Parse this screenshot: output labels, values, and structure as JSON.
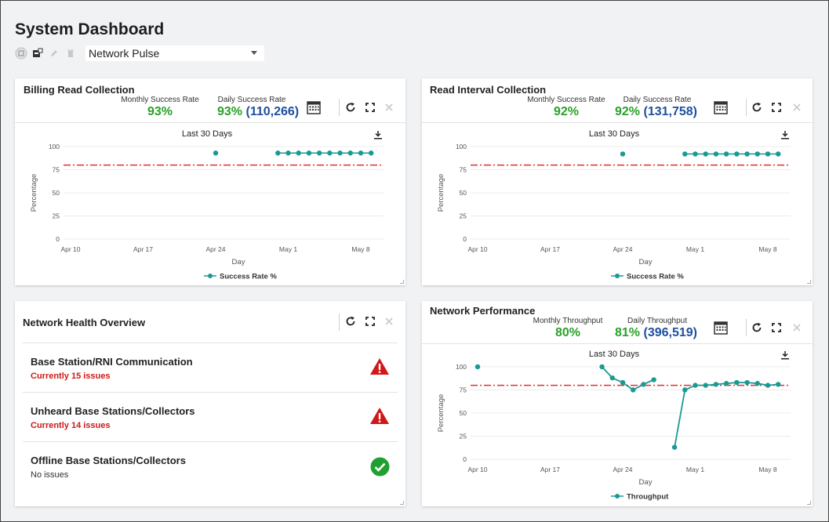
{
  "page": {
    "title": "System Dashboard"
  },
  "toolbar": {
    "selected_view": "Network Pulse"
  },
  "colors": {
    "accent_green": "#2aa02a",
    "accent_blue": "#1f4f9e",
    "teal": "#1a9a94",
    "threshold_red": "#e03030",
    "alert_red": "#d01818"
  },
  "cards": {
    "billing": {
      "title": "Billing Read Collection",
      "monthly_label": "Monthly Success Rate",
      "monthly_value": "93%",
      "daily_label": "Daily Success Rate",
      "daily_pct": "93%",
      "daily_count": "(110,266)",
      "range_label": "Last 30 Days"
    },
    "interval": {
      "title": "Read Interval Collection",
      "monthly_label": "Monthly Success Rate",
      "monthly_value": "92%",
      "daily_label": "Daily Success Rate",
      "daily_pct": "92%",
      "daily_count": "(131,758)",
      "range_label": "Last 30 Days"
    },
    "health": {
      "title": "Network Health Overview",
      "items": [
        {
          "title": "Base Station/RNI Communication",
          "status": "Currently 15 issues",
          "icon": "warning-icon"
        },
        {
          "title": "Unheard Base Stations/Collectors",
          "status": "Currently 14 issues",
          "icon": "warning-icon"
        },
        {
          "title": "Offline Base Stations/Collectors",
          "status": "No issues",
          "icon": "check-circle-icon"
        }
      ]
    },
    "performance": {
      "title": "Network Performance",
      "monthly_label": "Monthly Throughput",
      "monthly_value": "80%",
      "daily_label": "Daily Throughput",
      "daily_pct": "81%",
      "daily_count": "(396,519)",
      "range_label": "Last 30 Days"
    }
  },
  "chart_data": [
    {
      "id": "billing",
      "type": "line",
      "xlabel": "Day",
      "ylabel": "Percentage",
      "x_tick_labels": [
        "Apr 10",
        "Apr 17",
        "Apr 24",
        "May 1",
        "May 8"
      ],
      "x_tick_dates": [
        "2024-04-10",
        "2024-04-17",
        "2024-04-24",
        "2024-05-01",
        "2024-05-08"
      ],
      "y_ticks": [
        0,
        25,
        50,
        75,
        100
      ],
      "ylim": [
        0,
        100
      ],
      "threshold": 80,
      "series": [
        {
          "name": "Success Rate %",
          "color": "#1a9a94",
          "connect": false,
          "points": [
            [
              "2024-04-24",
              93
            ],
            [
              "2024-04-30",
              93
            ],
            [
              "2024-05-01",
              93
            ],
            [
              "2024-05-02",
              93
            ],
            [
              "2024-05-03",
              93
            ],
            [
              "2024-05-04",
              93
            ],
            [
              "2024-05-05",
              93
            ],
            [
              "2024-05-06",
              93
            ],
            [
              "2024-05-07",
              93
            ],
            [
              "2024-05-08",
              93
            ],
            [
              "2024-05-09",
              93
            ]
          ]
        }
      ]
    },
    {
      "id": "interval",
      "type": "line",
      "xlabel": "Day",
      "ylabel": "Percentage",
      "x_tick_labels": [
        "Apr 10",
        "Apr 17",
        "Apr 24",
        "May 1",
        "May 8"
      ],
      "x_tick_dates": [
        "2024-04-10",
        "2024-04-17",
        "2024-04-24",
        "2024-05-01",
        "2024-05-08"
      ],
      "y_ticks": [
        0,
        25,
        50,
        75,
        100
      ],
      "ylim": [
        0,
        100
      ],
      "threshold": 80,
      "series": [
        {
          "name": "Success Rate %",
          "color": "#1a9a94",
          "connect": false,
          "points": [
            [
              "2024-04-24",
              92
            ],
            [
              "2024-04-30",
              92
            ],
            [
              "2024-05-01",
              92
            ],
            [
              "2024-05-02",
              92
            ],
            [
              "2024-05-03",
              92
            ],
            [
              "2024-05-04",
              92
            ],
            [
              "2024-05-05",
              92
            ],
            [
              "2024-05-06",
              92
            ],
            [
              "2024-05-07",
              92
            ],
            [
              "2024-05-08",
              92
            ],
            [
              "2024-05-09",
              92
            ]
          ]
        }
      ]
    },
    {
      "id": "performance",
      "type": "line",
      "xlabel": "Day",
      "ylabel": "Percentage",
      "x_tick_labels": [
        "Apr 10",
        "Apr 17",
        "Apr 24",
        "May 1",
        "May 8"
      ],
      "x_tick_dates": [
        "2024-04-10",
        "2024-04-17",
        "2024-04-24",
        "2024-05-01",
        "2024-05-08"
      ],
      "y_ticks": [
        0,
        25,
        50,
        75,
        100
      ],
      "ylim": [
        0,
        100
      ],
      "threshold": 80,
      "series": [
        {
          "name": "Throughput",
          "color": "#1a9a94",
          "connect": true,
          "segments": [
            [
              [
                "2024-04-10",
                100
              ]
            ],
            [
              [
                "2024-04-22",
                100
              ],
              [
                "2024-04-23",
                88
              ],
              [
                "2024-04-24",
                83
              ],
              [
                "2024-04-25",
                75
              ],
              [
                "2024-04-26",
                81
              ],
              [
                "2024-04-27",
                86
              ]
            ],
            [
              [
                "2024-04-29",
                13
              ],
              [
                "2024-04-30",
                75
              ],
              [
                "2024-05-01",
                80
              ],
              [
                "2024-05-02",
                80
              ],
              [
                "2024-05-03",
                81
              ],
              [
                "2024-05-04",
                82
              ],
              [
                "2024-05-05",
                83
              ],
              [
                "2024-05-06",
                83
              ],
              [
                "2024-05-07",
                82
              ],
              [
                "2024-05-08",
                80
              ],
              [
                "2024-05-09",
                81
              ]
            ]
          ]
        }
      ]
    }
  ]
}
